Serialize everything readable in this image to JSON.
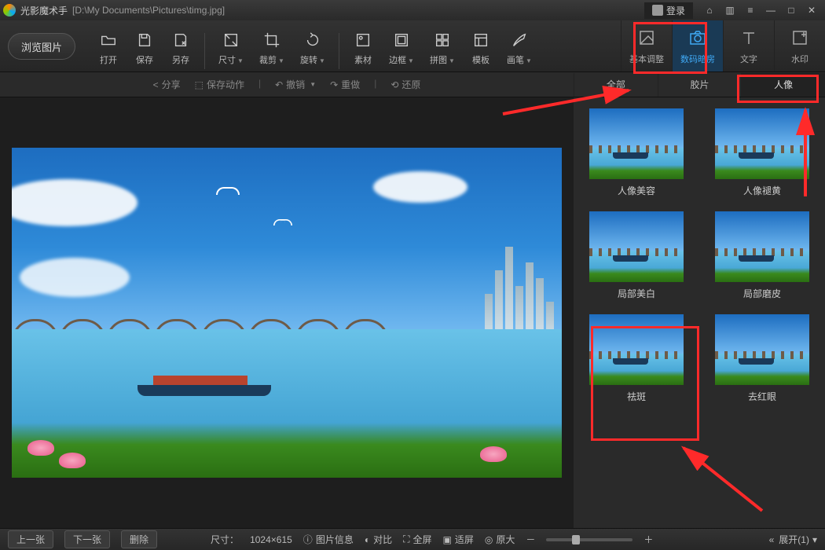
{
  "app": {
    "name": "光影魔术手",
    "file_path": "[D:\\My Documents\\Pictures\\timg.jpg]",
    "login": "登录"
  },
  "toolbar": {
    "browse": "浏览图片",
    "items": [
      "打开",
      "保存",
      "另存",
      "尺寸",
      "裁剪",
      "旋转",
      "素材",
      "边框",
      "拼图",
      "模板",
      "画笔"
    ]
  },
  "right_tabs": [
    "基本调整",
    "数码暗房",
    "文字",
    "水印"
  ],
  "secbar": {
    "share": "分享",
    "save_action": "保存动作",
    "undo": "撤销",
    "redo": "重做",
    "restore": "还原"
  },
  "category_tabs": [
    "全部",
    "胶片",
    "人像"
  ],
  "effects": [
    "人像美容",
    "人像褪黄",
    "局部美白",
    "局部磨皮",
    "祛斑",
    "去红眼"
  ],
  "status": {
    "prev": "上一张",
    "next": "下一张",
    "delete": "删除",
    "size_label": "尺寸：",
    "size_value": "1024×615",
    "info": "图片信息",
    "compare": "对比",
    "fullscreen": "全屏",
    "fit": "适屏",
    "orig": "原大",
    "expand": "展开(1)"
  }
}
